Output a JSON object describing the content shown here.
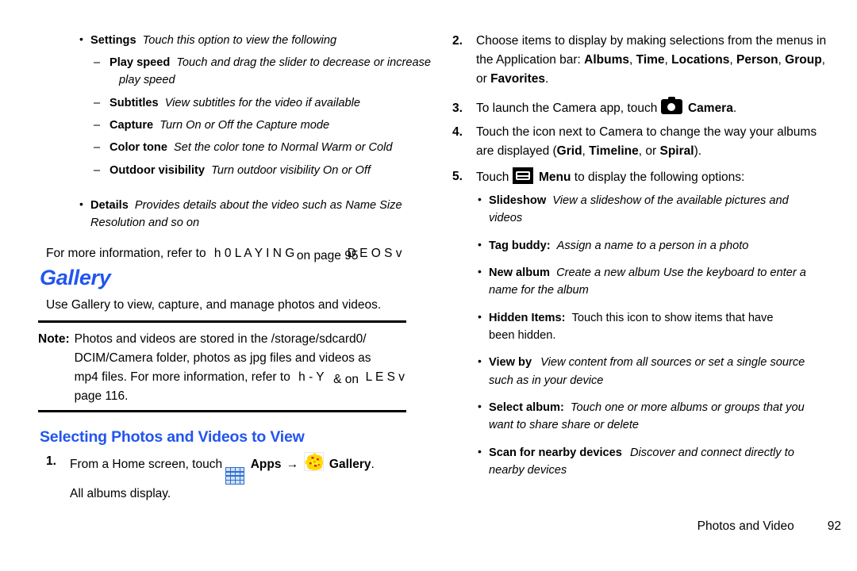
{
  "page": {
    "footer_title": "Photos and Video",
    "footer_page_number": "92"
  },
  "left_column": {
    "settings_bullet": {
      "term": "Settings",
      "desc": "Touch this option to view the following"
    },
    "settings_sub_items": [
      {
        "term": "Play speed",
        "desc": "Touch and drag the slider to decrease or increase",
        "desc_cont": "play speed"
      },
      {
        "term": "Subtitles",
        "desc": "View subtitles for the video  if available",
        "desc_cont": ""
      },
      {
        "term": "Capture",
        "desc": "Turn On or Off the Capture mode",
        "desc_cont": ""
      },
      {
        "term": "Color tone",
        "desc": "Set the color tone to Normal  Warm  or Cold",
        "desc_cont": ""
      },
      {
        "term": "Outdoor visibility",
        "desc": "Turn outdoor visibility On or Off",
        "desc_cont": ""
      }
    ],
    "details_bullet": {
      "term": "Details",
      "desc": "Provides details about the video  such as Name  Size",
      "desc_cont": "Resolution  and so on"
    },
    "crossref_line": {
      "prefix": "For more information, refer to",
      "garbled_a": "h 0 L A Y I N G",
      "garbled_b": "on page 95",
      "garbled_c": "D E O S v"
    },
    "gallery_heading": "Gallery",
    "gallery_intro": "Use Gallery to view, capture, and manage photos and videos.",
    "note": {
      "label": "Note:",
      "line1": "Photos and videos are stored in the /storage/sdcard0/",
      "line2": "DCIM/Camera folder, photos as jpg files and videos as",
      "line3_prefix": "mp4 files. For more information, refer to",
      "line3_garbled_a": "h - Y",
      "line3_garbled_b": "&  on",
      "line3_garbled_c": "L E S v",
      "line4": "page 116."
    },
    "section_heading": "Selecting Photos and Videos to View",
    "step1": {
      "index": "1.",
      "prefix": "From a Home screen, touch",
      "apps_label": "Apps",
      "arrow": "→",
      "gallery_label": "Gallery",
      "period": ".",
      "result": "All albums display."
    }
  },
  "right_column": {
    "step2": {
      "index": "2.",
      "text_a": "Choose items to display by making selections from the menus in the Application bar: ",
      "menu_items": [
        "Albums",
        "Time",
        "Locations",
        "Person",
        "Group",
        "Favorites"
      ],
      "text_b": ", or ",
      "period": "."
    },
    "step3": {
      "index": "3.",
      "prefix": "To launch the Camera app, touch",
      "camera_label": "Camera",
      "period": "."
    },
    "step4": {
      "index": "4.",
      "text_a": "Touch the icon next to Camera to change the way your albums are displayed (",
      "options": [
        "Grid",
        "Timeline",
        "Spiral"
      ],
      "text_b": ", or ",
      "text_c": ")."
    },
    "step5": {
      "index": "5.",
      "prefix": "Touch",
      "menu_label": "Menu",
      "suffix": "to display the following options:"
    },
    "menu_options": [
      {
        "term": "Slideshow",
        "desc": "View a slideshow of the available pictures and",
        "desc_cont": "videos",
        "desc_plain": false
      },
      {
        "term": "Tag buddy:",
        "desc": "Assign a name to a person in a photo",
        "desc_cont": "",
        "desc_plain": false
      },
      {
        "term": "New album",
        "desc": "Create a new album  Use the keyboard to enter a",
        "desc_cont": "name for the album",
        "desc_plain": false
      },
      {
        "term": "Hidden Items:",
        "desc": "Touch this icon to show items that have",
        "desc_cont": "been hidden.",
        "desc_plain": true
      },
      {
        "term": "View by",
        "desc": "View content from all sources or set a single source",
        "desc_cont": "such as in your device",
        "desc_plain": false
      },
      {
        "term": "Select album:",
        "desc": "Touch one or more albums or groups that you",
        "desc_cont": "want to share  share  or delete",
        "desc_plain": false
      },
      {
        "term": "Scan for nearby devices",
        "desc": "Discover and connect directly to",
        "desc_cont": "nearby devices",
        "desc_plain": false
      }
    ]
  },
  "colors": {
    "heading_blue": "#2255ee",
    "apps_icon_blue": "#2f6fd0",
    "gallery_icon_yellow": "#ffe000",
    "gallery_icon_red": "#e02020",
    "text_black": "#000000"
  }
}
